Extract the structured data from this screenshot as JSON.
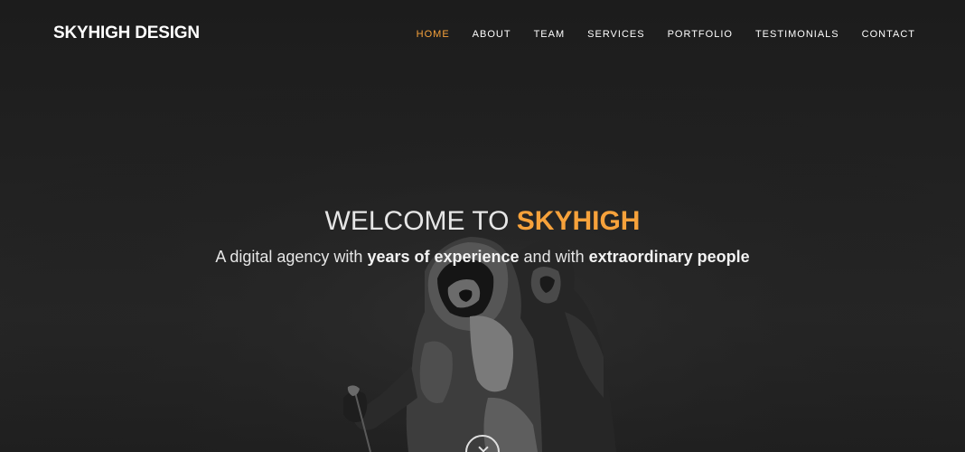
{
  "brand": {
    "name": "SKYHIGH DESIGN"
  },
  "nav": {
    "items": [
      {
        "label": "HOME"
      },
      {
        "label": "ABOUT"
      },
      {
        "label": "TEAM"
      },
      {
        "label": "SERVICES"
      },
      {
        "label": "PORTFOLIO"
      },
      {
        "label": "TESTIMONIALS"
      },
      {
        "label": "CONTACT"
      }
    ],
    "active_item": "HOME"
  },
  "hero": {
    "headline_prefix": "WELCOME TO ",
    "headline_accent": "SKYHIGH",
    "tagline": {
      "part1": "A digital agency with ",
      "bold1": "years of experience",
      "part2": " and with ",
      "bold2": "extraordinary people"
    },
    "scroll_icon": "chevron-down-icon"
  },
  "colors": {
    "accent": "#f7a23b",
    "background": "#1b1b1b",
    "text": "#e6e6e6"
  }
}
